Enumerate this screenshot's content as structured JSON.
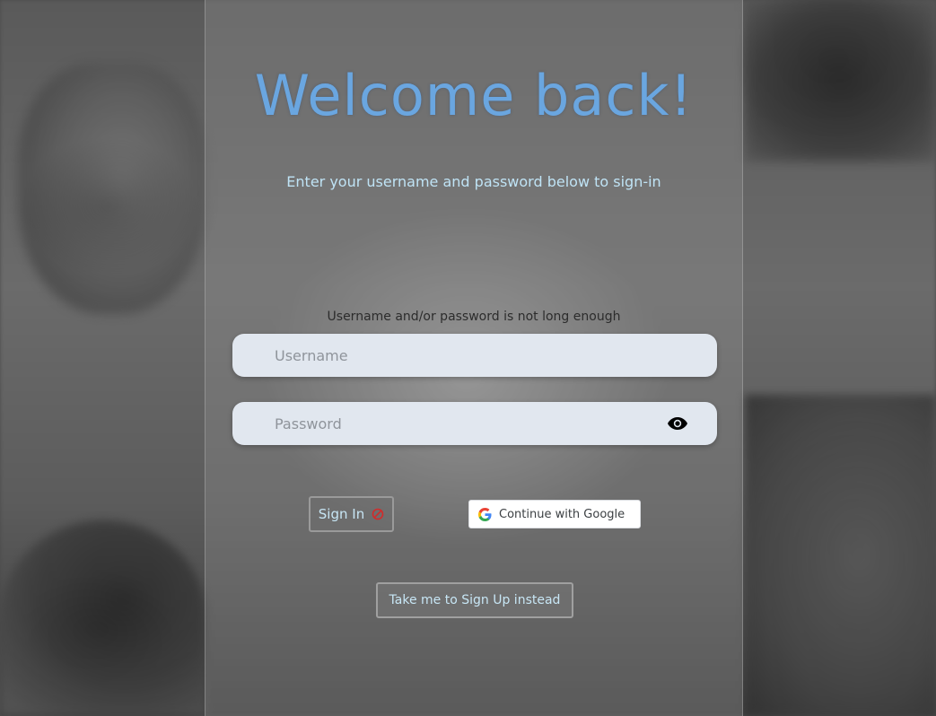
{
  "heading": {
    "title": "Welcome back!",
    "subtitle": "Enter your username and password below to sign-in"
  },
  "form": {
    "error_message": "Username and/or password is not long enough",
    "username": {
      "placeholder": "Username",
      "value": ""
    },
    "password": {
      "placeholder": "Password",
      "value": ""
    },
    "toggle_password_icon": "eye-icon"
  },
  "actions": {
    "sign_in_label": "Sign In",
    "sign_in_disabled_icon": "no-entry-icon",
    "google_label": "Continue with Google",
    "sign_up_label": "Take me to Sign Up instead"
  },
  "colors": {
    "title": "#6aa6e0",
    "subtitle": "#bfe3f5",
    "field_bg": "#e1e7ef",
    "disabled_icon": "#d22b2b"
  }
}
